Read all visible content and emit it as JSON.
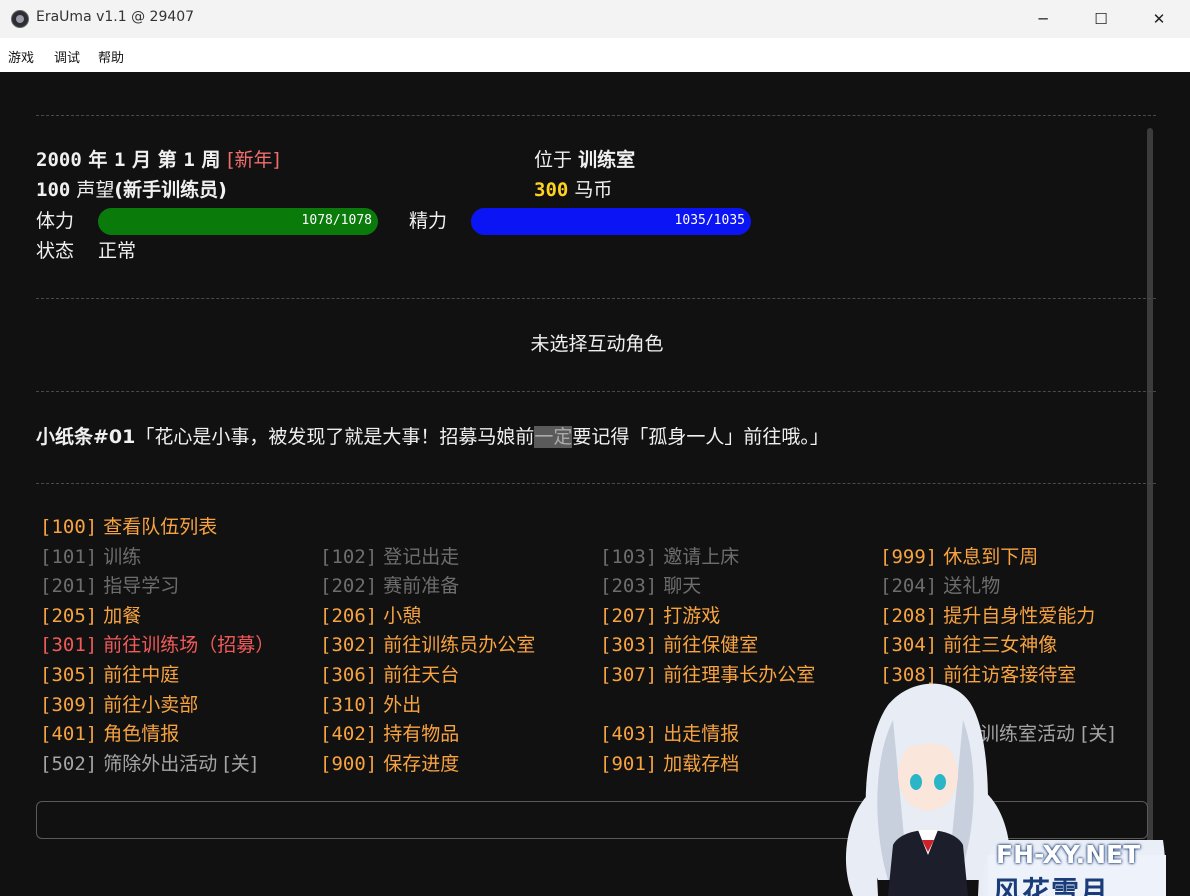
{
  "window": {
    "title": "EraUma v1.1 @ 29407",
    "minimize": "─",
    "maximize": "☐",
    "close": "✕"
  },
  "menu": [
    "游戏",
    "调试",
    "帮助"
  ],
  "status": {
    "year": "2000",
    "year_unit": "年",
    "month": "1",
    "month_unit": "月",
    "week_prefix": "第",
    "week": "1",
    "week_unit": "周",
    "event": "[新年]",
    "location_label": "位于",
    "location": "训练室",
    "reputation": "100",
    "reputation_label": "声望",
    "rank": "(新手训练员)",
    "money": "300",
    "money_label": "马币",
    "stamina_label": "体力",
    "stamina_text": "1078/1078",
    "stamina_fraction": 1.0,
    "energy_label": "精力",
    "energy_text": "1035/1035",
    "energy_fraction": 1.0,
    "state_label": "状态",
    "state_value": "正常"
  },
  "interaction": "未选择互动角色",
  "note": {
    "label": "小纸条#01",
    "before": "「花心是小事，被发现了就是大事！招募马娘前",
    "highlight": "一定",
    "after": "要记得「孤身一人」前往哦。」"
  },
  "options": [
    {
      "num": "[100]",
      "label": "查看队伍列表",
      "color": "orange"
    },
    {
      "num": "[101]",
      "label": "训练",
      "color": "gray"
    },
    {
      "num": "[102]",
      "label": "登记出走",
      "color": "gray"
    },
    {
      "num": "[103]",
      "label": "邀请上床",
      "color": "gray"
    },
    {
      "num": "[999]",
      "label": "休息到下周",
      "color": "orange"
    },
    {
      "num": "[201]",
      "label": "指导学习",
      "color": "gray"
    },
    {
      "num": "[202]",
      "label": "赛前准备",
      "color": "gray"
    },
    {
      "num": "[203]",
      "label": "聊天",
      "color": "gray"
    },
    {
      "num": "[204]",
      "label": "送礼物",
      "color": "gray"
    },
    {
      "num": "[205]",
      "label": "加餐",
      "color": "orange"
    },
    {
      "num": "[206]",
      "label": "小憩",
      "color": "orange"
    },
    {
      "num": "[207]",
      "label": "打游戏",
      "color": "orange"
    },
    {
      "num": "[208]",
      "label": "提升自身性爱能力",
      "color": "orange"
    },
    {
      "num": "[301]",
      "label": "前往训练场（招募）",
      "color": "red"
    },
    {
      "num": "[302]",
      "label": "前往训练员办公室",
      "color": "orange"
    },
    {
      "num": "[303]",
      "label": "前往保健室",
      "color": "orange"
    },
    {
      "num": "[304]",
      "label": "前往三女神像",
      "color": "orange"
    },
    {
      "num": "[305]",
      "label": "前往中庭",
      "color": "orange"
    },
    {
      "num": "[306]",
      "label": "前往天台",
      "color": "orange"
    },
    {
      "num": "[307]",
      "label": "前往理事长办公室",
      "color": "orange"
    },
    {
      "num": "[308]",
      "label": "前往访客接待室",
      "color": "orange"
    },
    {
      "num": "[309]",
      "label": "前往小卖部",
      "color": "orange"
    },
    {
      "num": "[310]",
      "label": "外出",
      "color": "orange"
    },
    {
      "num": "[401]",
      "label": "角色情报",
      "color": "orange"
    },
    {
      "num": "[402]",
      "label": "持有物品",
      "color": "orange"
    },
    {
      "num": "[403]",
      "label": "出走情报",
      "color": "orange"
    },
    {
      "num": "",
      "label": "筛除训练室活动 [关]",
      "color": "lgray"
    },
    {
      "num": "[502]",
      "label": "筛除外出活动 [关]",
      "color": "lgray"
    },
    {
      "num": "[900]",
      "label": "保存进度",
      "color": "orange"
    },
    {
      "num": "[901]",
      "label": "加载存档",
      "color": "orange"
    }
  ],
  "watermark": {
    "line1": "FH-XY.NET",
    "line2": "风花雪月"
  },
  "colors": {
    "orange": "#f7a341",
    "gray": "#6d6d6d",
    "red": "#f05a5a",
    "light_gray": "#a5a5a5",
    "stamina_bar": "#0a7a0a",
    "energy_bar": "#0a14f5",
    "money": "#ffd21e",
    "event": "#f06e6e"
  }
}
